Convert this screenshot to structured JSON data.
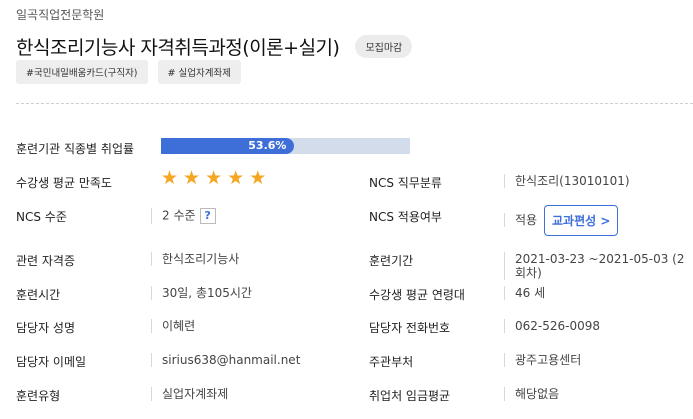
{
  "header": {
    "institute": "일곡직업전문학원",
    "title": "한식조리기능사 자격취득과정(이론+실기)",
    "status_badge": "모집마감",
    "tags": [
      "#국민내일배움카드(구직자)",
      "# 실업자계좌제"
    ]
  },
  "details": {
    "employment_rate": {
      "label": "훈련기관 직종별 취업률",
      "value": "53.6%",
      "percent": 53.6
    },
    "satisfaction": {
      "label": "수강생 평균 만족도",
      "stars": 5
    },
    "ncs_category": {
      "label": "NCS 직무분류",
      "value": "한식조리(13010101)"
    },
    "ncs_level": {
      "label": "NCS 수준",
      "value": "2 수준",
      "help": "?"
    },
    "ncs_applied": {
      "label": "NCS 적용여부",
      "value": "적용",
      "button": "교과편성 >"
    },
    "certificate": {
      "label": "관련 자격증",
      "value": "한식조리기능사"
    },
    "period": {
      "label": "훈련기간",
      "value": "2021-03-23 ~2021-05-03 (2회차)"
    },
    "hours": {
      "label": "훈련시간",
      "value": "30일, 총105시간"
    },
    "avg_age": {
      "label": "수강생 평균 연령대",
      "value": "46 세"
    },
    "manager_name": {
      "label": "담당자 성명",
      "value": "이혜련"
    },
    "manager_phone": {
      "label": "담당자 전화번호",
      "value": "062-526-0098"
    },
    "manager_email": {
      "label": "담당자 이메일",
      "value": "sirius638@hanmail.net"
    },
    "department": {
      "label": "주관부처",
      "value": "광주고용센터"
    },
    "training_type": {
      "label": "훈련유형",
      "value": "실업자계좌제"
    },
    "avg_wage": {
      "label": "취업처 임금평균",
      "value": "해당없음"
    }
  },
  "colors": {
    "accent": "#3e6fd9",
    "star": "#f5a623",
    "bar_track": "#d3dcea"
  }
}
